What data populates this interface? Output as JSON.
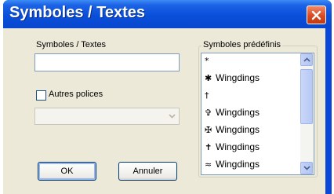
{
  "window": {
    "title": "Symboles / Textes",
    "close_icon": "close-icon"
  },
  "left": {
    "text_label": "Symboles / Textes",
    "text_value": "",
    "other_fonts_label": "Autres polices",
    "other_fonts_checked": false,
    "font_select_value": ""
  },
  "predefined": {
    "group_label": "Symboles prédéfinis",
    "items": [
      {
        "glyph": "*",
        "text": ""
      },
      {
        "glyph": "✱",
        "text": "Wingdings"
      },
      {
        "glyph": "†",
        "text": ""
      },
      {
        "glyph": "✞",
        "text": "Wingdings"
      },
      {
        "glyph": "✠",
        "text": "Wingdings"
      },
      {
        "glyph": "✝",
        "text": "Wingdings"
      },
      {
        "glyph": "≈",
        "text": "Wingdings"
      }
    ]
  },
  "buttons": {
    "ok_label": "OK",
    "cancel_label": "Annuler"
  },
  "colors": {
    "titlebar": "#0a4fd9",
    "close_button": "#d84b22",
    "dialog_face": "#ece9d8"
  }
}
